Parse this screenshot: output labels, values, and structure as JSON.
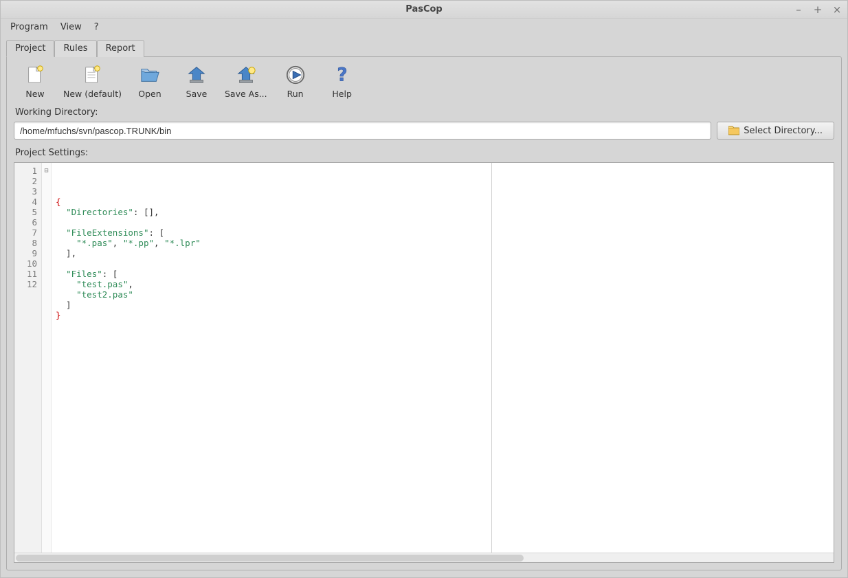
{
  "window": {
    "title": "PasCop"
  },
  "menubar": {
    "items": [
      "Program",
      "View",
      "?"
    ]
  },
  "tabs": {
    "items": [
      {
        "label": "Project",
        "active": true
      },
      {
        "label": "Rules",
        "active": false
      },
      {
        "label": "Report",
        "active": false
      }
    ]
  },
  "toolbar": {
    "new": {
      "label": "New"
    },
    "newdefault": {
      "label": "New (default)"
    },
    "open": {
      "label": "Open"
    },
    "save": {
      "label": "Save"
    },
    "saveas": {
      "label": "Save As..."
    },
    "run": {
      "label": "Run"
    },
    "help": {
      "label": "Help"
    }
  },
  "labels": {
    "working_dir": "Working Directory:",
    "project_settings": "Project Settings:",
    "select_dir": "Select Directory..."
  },
  "working_dir": {
    "value": "/home/mfuchs/svn/pascop.TRUNK/bin"
  },
  "editor": {
    "line_count": 12,
    "lines": [
      {
        "n": 1,
        "segs": [
          {
            "t": "{",
            "c": "br"
          }
        ]
      },
      {
        "n": 2,
        "segs": [
          {
            "t": "  "
          },
          {
            "t": "\"Directories\"",
            "c": "key"
          },
          {
            "t": ": [],"
          }
        ]
      },
      {
        "n": 3,
        "segs": []
      },
      {
        "n": 4,
        "segs": [
          {
            "t": "  "
          },
          {
            "t": "\"FileExtensions\"",
            "c": "key"
          },
          {
            "t": ": ["
          }
        ]
      },
      {
        "n": 5,
        "segs": [
          {
            "t": "    "
          },
          {
            "t": "\"*.pas\"",
            "c": "key"
          },
          {
            "t": ", "
          },
          {
            "t": "\"*.pp\"",
            "c": "key"
          },
          {
            "t": ", "
          },
          {
            "t": "\"*.lpr\"",
            "c": "key"
          }
        ]
      },
      {
        "n": 6,
        "segs": [
          {
            "t": "  ],"
          }
        ]
      },
      {
        "n": 7,
        "segs": []
      },
      {
        "n": 8,
        "segs": [
          {
            "t": "  "
          },
          {
            "t": "\"Files\"",
            "c": "key"
          },
          {
            "t": ": ["
          }
        ]
      },
      {
        "n": 9,
        "segs": [
          {
            "t": "    "
          },
          {
            "t": "\"test.pas\"",
            "c": "key"
          },
          {
            "t": ","
          }
        ]
      },
      {
        "n": 10,
        "segs": [
          {
            "t": "    "
          },
          {
            "t": "\"test2.pas\"",
            "c": "key"
          }
        ]
      },
      {
        "n": 11,
        "segs": [
          {
            "t": "  ]"
          }
        ]
      },
      {
        "n": 12,
        "segs": [
          {
            "t": "}",
            "c": "br"
          }
        ]
      }
    ]
  }
}
